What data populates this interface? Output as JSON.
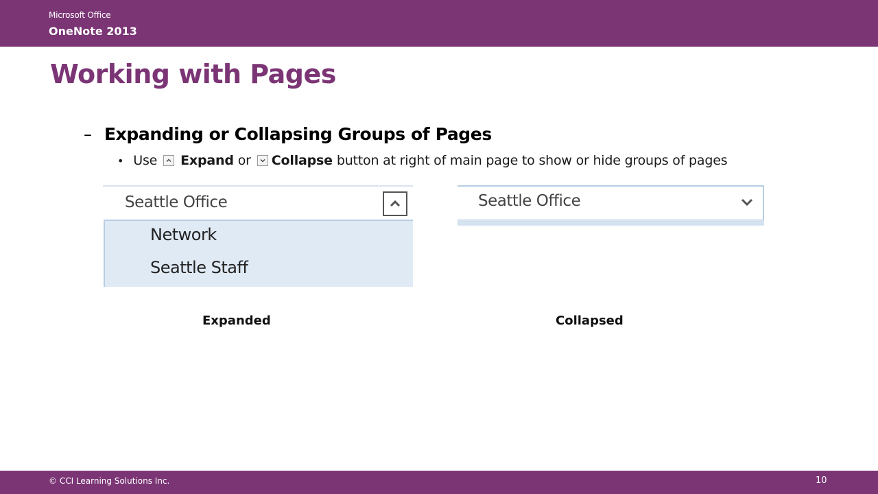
{
  "header": {
    "brand": "Microsoft Office",
    "product": "OneNote 2013"
  },
  "slide": {
    "title": "Working with Pages",
    "dash": "–",
    "subheading": "Expanding or Collapsing Groups of Pages",
    "bullet": {
      "dot": "•",
      "use": "Use",
      "expand": "Expand",
      "or": "or",
      "collapse": "Collapse",
      "rest": "button at right of main page to show or hide groups of pages"
    }
  },
  "expanded_panel": {
    "header_label": "Seattle Office",
    "items": [
      "Network",
      "Seattle Staff"
    ],
    "caption": "Expanded"
  },
  "collapsed_panel": {
    "header_label": "Seattle Office",
    "caption": "Collapsed"
  },
  "footer": {
    "copyright": "© CCI Learning Solutions Inc.",
    "page_number": "10"
  },
  "colors": {
    "brand_purple": "#7b3575",
    "panel_blue": "#e0eaf5"
  },
  "icons": [
    "expand-icon",
    "collapse-icon",
    "chevron-up-icon",
    "chevron-down-icon"
  ]
}
